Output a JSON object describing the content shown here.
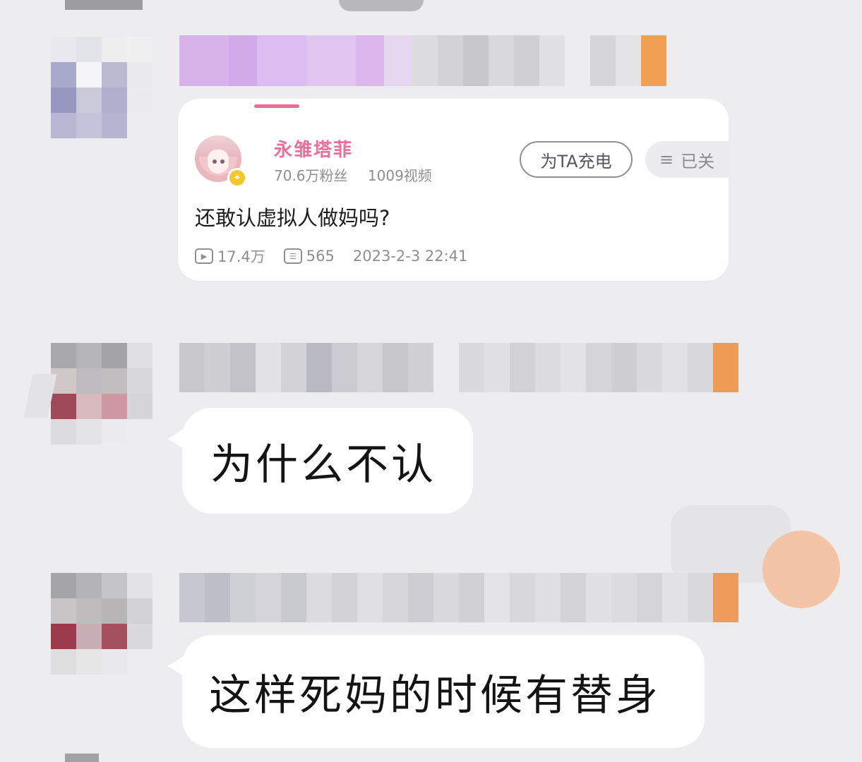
{
  "shared_card": {
    "uploader_name": "永雏塔菲",
    "followers": "70.6万粉丝",
    "videos": "1009视频",
    "charge_button": "为TA充电",
    "follow_button": "已关",
    "title": "还敢认虚拟人做妈吗?",
    "play_count": "17.4万",
    "comment_count": "565",
    "publish_time": "2023-2-3 22:41",
    "icons": [
      "play-icon",
      "comment-icon",
      "menu-icon",
      "verified-badge-icon"
    ]
  },
  "messages": [
    {
      "text": "为什么不认"
    },
    {
      "text": "这样死妈的时候有替身"
    }
  ],
  "colors": {
    "background": "#ededef",
    "accent_pink": "#e8709b",
    "bubble": "#ffffff"
  }
}
